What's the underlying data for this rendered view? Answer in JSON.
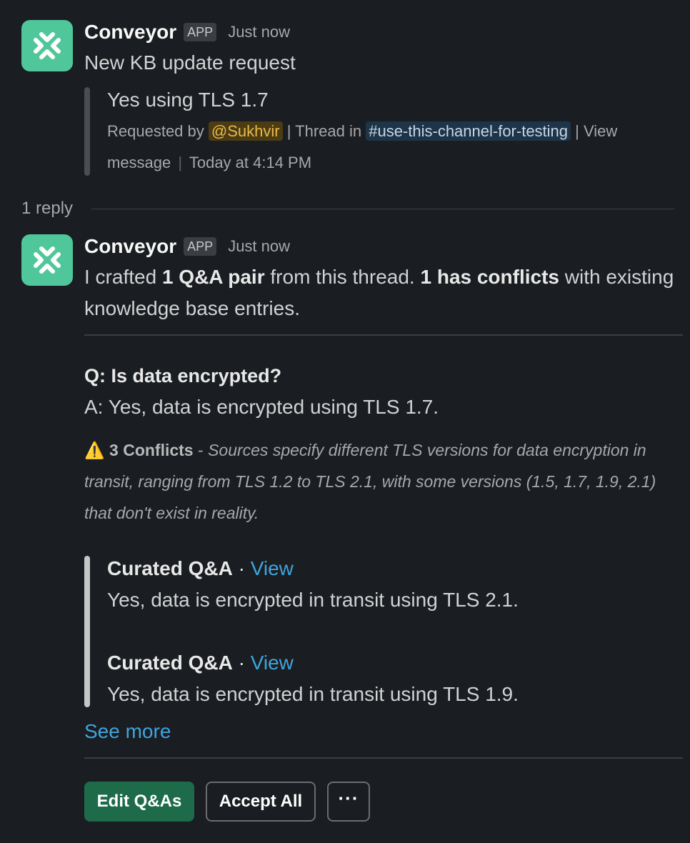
{
  "message1": {
    "sender": "Conveyor",
    "badge": "APP",
    "time": "Just now",
    "text": "New KB update request",
    "quote": {
      "title": "Yes using TLS 1.7",
      "requested_by_prefix": "Requested by",
      "mention": "@Sukhvir",
      "thread_in": "| Thread in",
      "channel": "#use-this-channel-for-testing",
      "view_prefix": "| View",
      "view_suffix": "message",
      "sep": "|",
      "date": "Today at 4:14 PM"
    }
  },
  "replies": {
    "count_label": "1 reply"
  },
  "message2": {
    "sender": "Conveyor",
    "badge": "APP",
    "time": "Just now",
    "intro": {
      "part1": "I crafted ",
      "bold1": "1 Q&A pair",
      "part2": " from this thread. ",
      "bold2": "1 has conflicts",
      "part3": " with existing knowledge base entries."
    },
    "qa": {
      "question": "Q: Is data encrypted?",
      "answer": "A: Yes, data is encrypted using TLS 1.7."
    },
    "conflict": {
      "icon": "⚠️",
      "title": "3 Conflicts",
      "dash": " - ",
      "description": "Sources specify different TLS versions for data encryption in transit, ranging from TLS 1.2 to TLS 2.1, with some versions (1.5, 1.7, 1.9, 2.1) that don't exist in reality."
    },
    "curated": [
      {
        "title": "Curated Q&A",
        "dot": " · ",
        "link": "View",
        "text": "Yes, data is encrypted in transit using TLS 2.1."
      },
      {
        "title": "Curated Q&A",
        "dot": " · ",
        "link": "View",
        "text": "Yes, data is encrypted in transit using TLS 1.9."
      }
    ],
    "see_more": "See more",
    "buttons": {
      "edit": "Edit Q&As",
      "accept": "Accept All",
      "more": "···"
    }
  },
  "colors": {
    "background": "#1a1d21",
    "avatar": "#4fc79b",
    "link": "#3fa5de",
    "primary_button": "#1e6b4a",
    "mention_bg": "#4b3c14",
    "mention_fg": "#e8b94a"
  }
}
